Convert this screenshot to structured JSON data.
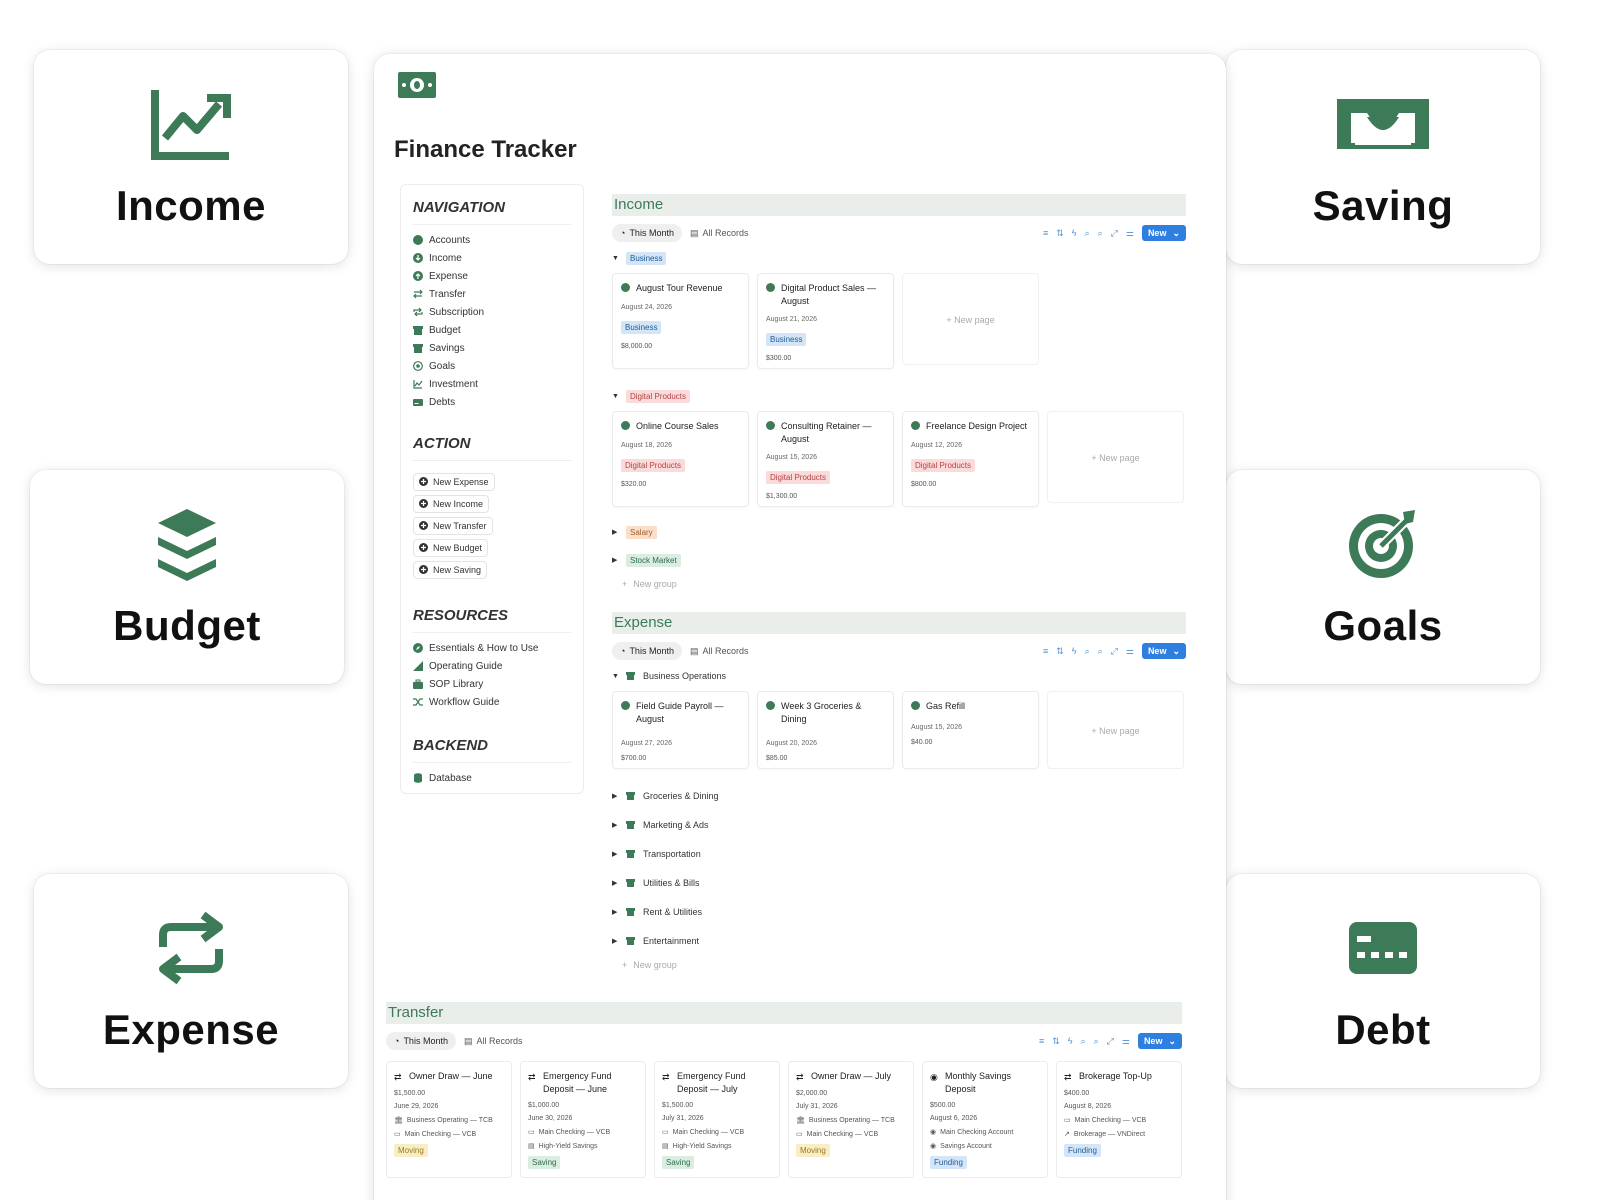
{
  "features": {
    "income": "Income",
    "saving": "Saving",
    "budget": "Budget",
    "goals": "Goals",
    "expense": "Expense",
    "debt": "Debt"
  },
  "colors": {
    "accent": "#3d7a57",
    "new_button": "#2f7fe0",
    "section_header_bg": "#e9eeeb"
  },
  "page": {
    "title": "Finance Tracker",
    "icon": "money-bill-icon"
  },
  "sidebar": {
    "navigation_heading": "NAVIGATION",
    "navigation": [
      "Accounts",
      "Income",
      "Expense",
      "Transfer",
      "Subscription",
      "Budget",
      "Savings",
      "Goals",
      "Investment",
      "Debts"
    ],
    "action_heading": "ACTION",
    "actions": [
      "New Expense",
      "New Income",
      "New Transfer",
      "New Budget",
      "New Saving"
    ],
    "resources_heading": "RESOURCES",
    "resources": [
      "Essentials & How to Use",
      "Operating Guide",
      "SOP Library",
      "Workflow Guide"
    ],
    "backend_heading": "BACKEND",
    "backend": [
      "Database"
    ]
  },
  "views": {
    "this_month": "This Month",
    "all_records": "All Records",
    "new": "New",
    "new_page": "New page",
    "new_group": "New group"
  },
  "income": {
    "title": "Income",
    "groups": [
      {
        "name": "Business",
        "cards": [
          {
            "title": "August Tour Revenue",
            "date": "August 24, 2026",
            "tag": "Business",
            "amount": "$8,000.00"
          },
          {
            "title": "Digital Product Sales — August",
            "date": "August 21, 2026",
            "tag": "Business",
            "amount": "$300.00"
          }
        ]
      },
      {
        "name": "Digital Products",
        "cards": [
          {
            "title": "Online Course Sales",
            "date": "August 18, 2026",
            "tag": "Digital Products",
            "amount": "$320.00"
          },
          {
            "title": "Consulting Retainer — August",
            "date": "August 15, 2026",
            "tag": "Digital Products",
            "amount": "$1,300.00"
          },
          {
            "title": "Freelance Design Project",
            "date": "August 12, 2026",
            "tag": "Digital Products",
            "amount": "$800.00"
          }
        ]
      },
      {
        "name": "Salary"
      },
      {
        "name": "Stock Market"
      }
    ]
  },
  "expense": {
    "title": "Expense",
    "groups": [
      {
        "name": "Business Operations",
        "cards": [
          {
            "title": "Field Guide Payroll — August",
            "date": "August 27, 2026",
            "amount": "$700.00"
          },
          {
            "title": "Week 3 Groceries & Dining",
            "date": "August 20, 2026",
            "amount": "$85.00"
          },
          {
            "title": "Gas Refill",
            "date": "August 15, 2026",
            "amount": "$40.00"
          }
        ]
      },
      {
        "name": "Groceries & Dining"
      },
      {
        "name": "Marketing & Ads"
      },
      {
        "name": "Transportation"
      },
      {
        "name": "Utilities & Bills"
      },
      {
        "name": "Rent & Utilities"
      },
      {
        "name": "Entertainment"
      }
    ]
  },
  "transfer": {
    "title": "Transfer",
    "cards": [
      {
        "title": "Owner Draw — June",
        "amount": "$1,500.00",
        "date": "June 29, 2026",
        "from": "Business Operating — TCB",
        "to": "Main Checking — VCB",
        "tag": "Moving"
      },
      {
        "title": "Emergency Fund Deposit — June",
        "amount": "$1,000.00",
        "date": "June 30, 2026",
        "from": "Main Checking — VCB",
        "to": "High-Yield Savings",
        "tag": "Saving"
      },
      {
        "title": "Emergency Fund Deposit — July",
        "amount": "$1,500.00",
        "date": "July 31, 2026",
        "from": "Main Checking — VCB",
        "to": "High-Yield Savings",
        "tag": "Saving"
      },
      {
        "title": "Owner Draw — July",
        "amount": "$2,000.00",
        "date": "July 31, 2026",
        "from": "Business Operating — TCB",
        "to": "Main Checking — VCB",
        "tag": "Moving"
      },
      {
        "title": "Monthly Savings Deposit",
        "amount": "$500.00",
        "date": "August 6, 2026",
        "from": "Main Checking Account",
        "to": "Savings Account",
        "tag": "Funding"
      },
      {
        "title": "Brokerage Top-Up",
        "amount": "$400.00",
        "date": "August 8, 2026",
        "from": "Main Checking — VCB",
        "to": "Brokerage — VNDirect",
        "tag": "Funding"
      }
    ]
  }
}
